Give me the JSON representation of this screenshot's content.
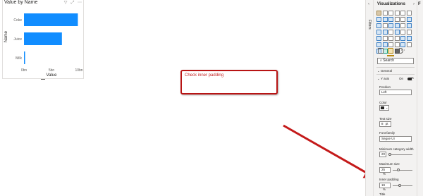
{
  "visual": {
    "title": "Value by Name",
    "header_icons": [
      "filter-icon",
      "focus-mode-icon",
      "more-options-icon"
    ]
  },
  "chart_data": {
    "type": "bar",
    "orientation": "horizontal",
    "categories": [
      "Coke",
      "Juice",
      "Milk"
    ],
    "values": [
      98000000000,
      69000000000,
      2000000000
    ],
    "xlabel": "Value",
    "ylabel": "Name",
    "xlim": [
      0,
      100000000000
    ],
    "ticks": [
      "0bn",
      "5bn",
      "10bn"
    ],
    "bar_color": "#118dff",
    "grid": false
  },
  "annotation": {
    "text": "Check inner padding",
    "color": "#b81414"
  },
  "filters_pane": {
    "label": "Filters"
  },
  "viz_pane": {
    "title": "Visualizations",
    "search_placeholder": "Search",
    "general_label": "General",
    "y_axis": {
      "label": "Y axis",
      "toggle_label": "On",
      "on": true
    },
    "position": {
      "label": "Position",
      "value": "Left"
    },
    "color": {
      "label": "Color",
      "value": "#252423"
    },
    "text_size": {
      "label": "Text size",
      "value": "8",
      "unit": "pt"
    },
    "font_family": {
      "label": "Font family",
      "value": "Segoe UI"
    },
    "min_category_width": {
      "label": "Minimum category width",
      "value": "20"
    },
    "maximum_size": {
      "label": "Maximum size",
      "value": "25",
      "unit": "%"
    },
    "inner_padding": {
      "label": "Inner padding",
      "value": "19",
      "unit": "%"
    },
    "title_section": {
      "label": "Title"
    }
  },
  "fields_pane": {
    "label": "F"
  }
}
